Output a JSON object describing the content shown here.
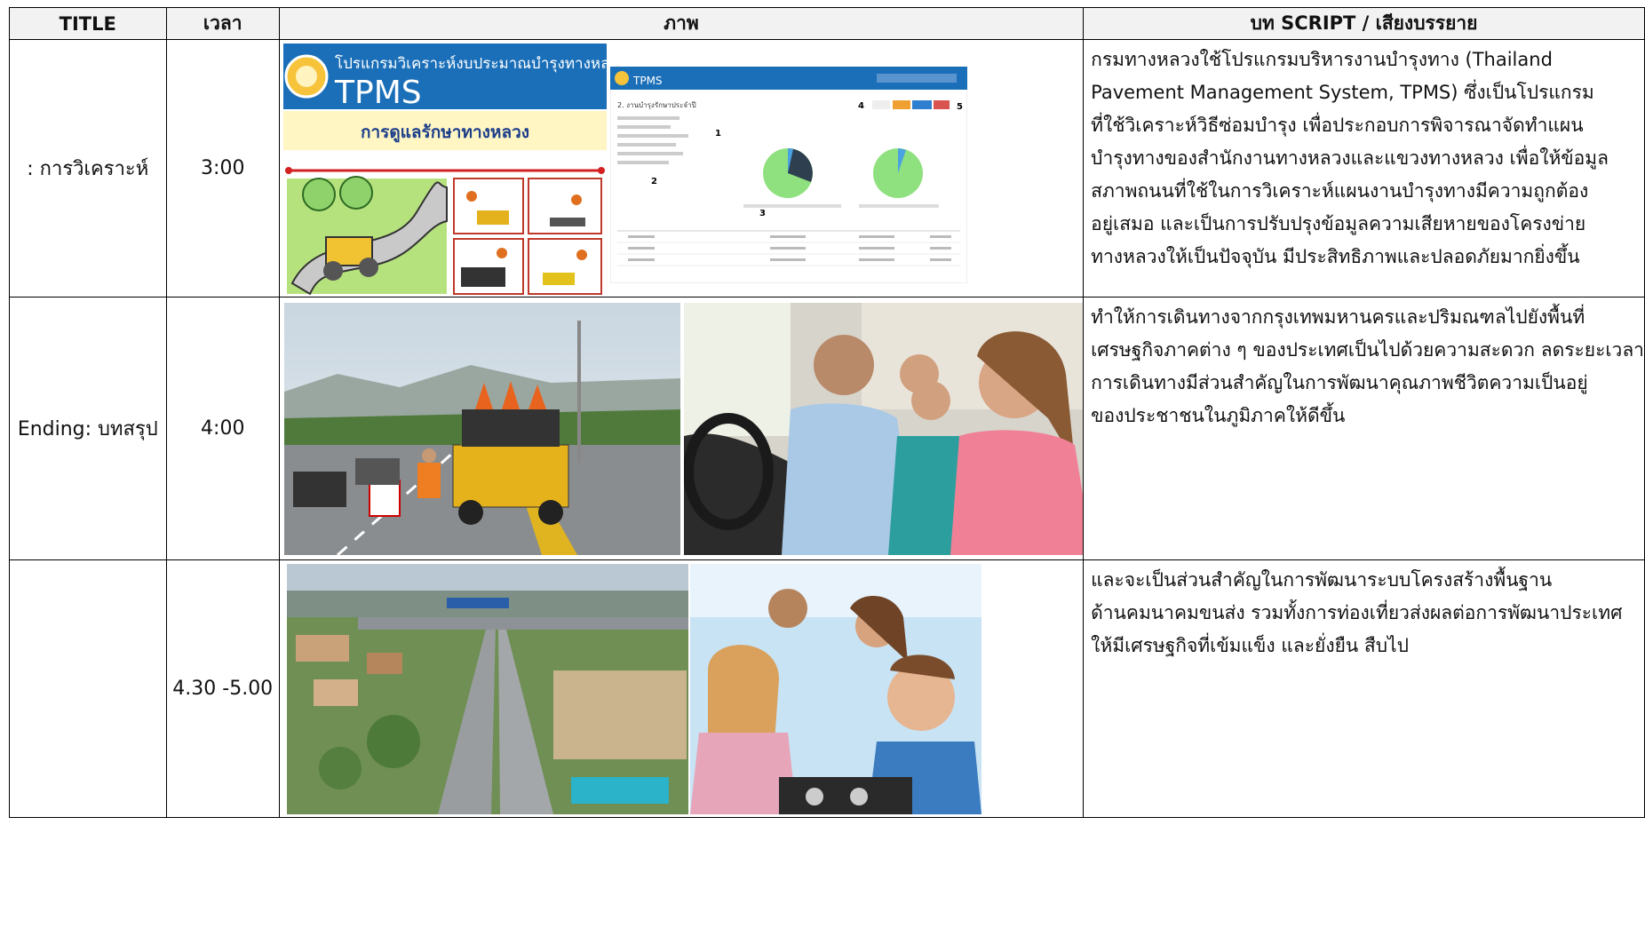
{
  "headers": {
    "title": "TITLE",
    "time": "เวลา",
    "image": "ภาพ",
    "script": "บท SCRIPT / เสียงบรรยาย"
  },
  "rows": [
    {
      "title": ": การวิเคราะห์",
      "time": "3:00",
      "script_lines": [
        "กรมทางหลวงใช้โปรแกรมบริหารงานบำรุงทาง (Thailand",
        "Pavement Management System, TPMS) ซึ่งเป็นโปรแกรม",
        "ที่ใช้วิเคราะห์วิธีซ่อมบำรุง เพื่อประกอบการพิจารณาจัดทำแผน",
        "บำรุงทางของสำนักงานทางหลวงและแขวงทางหลวง เพื่อให้ข้อมูล",
        "สภาพถนนที่ใช้ในการวิเคราะห์แผนงานบำรุงทางมีความถูกต้อง",
        "อยู่เสมอ และเป็นการปรับปรุงข้อมูลความเสียหายของโครงข่าย",
        "ทางหลวงให้เป็นปัจจุบัน มีประสิทธิภาพและปลอดภัยมากยิ่งขึ้น"
      ],
      "tpms": {
        "program_title": "โปรแกรมวิเคราะห์งบประมาณบำรุงทางหลวง",
        "logo_text": "TPMS",
        "banner": "การดูแลรักษาทางหลวง",
        "screen_header": "TPMS",
        "screen_section": "2. งานบำรุงรักษาประจำปี",
        "markers": [
          "1",
          "2",
          "3",
          "4",
          "5"
        ]
      }
    },
    {
      "title": "Ending: บทสรุป",
      "time": "4:00",
      "script_lines": [
        "ทำให้การเดินทางจากกรุงเทพมหานครและปริมณฑลไปยังพื้นที่",
        "เศรษฐกิจภาคต่าง ๆ ของประเทศเป็นไปด้วยความสะดวก ลดระยะเวลา",
        "การเดินทางมีส่วนสำคัญในการพัฒนาคุณภาพชีวิตความเป็นอยู่",
        "ของประชาชนในภูมิภาคให้ดีขึ้น"
      ]
    },
    {
      "title": "",
      "time": "4.30 -5.00",
      "script_lines": [
        "และจะเป็นส่วนสำคัญในการพัฒนาระบบโครงสร้างพื้นฐาน",
        "ด้านคมนาคมขนส่ง รวมทั้งการท่องเที่ยวส่งผลต่อการพัฒนาประเทศ",
        "ให้มีเศรษฐกิจที่เข้มแข็ง และยั่งยืน สืบไป"
      ]
    }
  ],
  "colors": {
    "tpms_blue": "#1a6fb8",
    "banner_yellow": "#fff6c4",
    "grass_green": "#9fd86b",
    "pie_green": "#8fe07f",
    "pie_dark": "#2e3f4f",
    "pie_blue": "#4aa3e0"
  }
}
